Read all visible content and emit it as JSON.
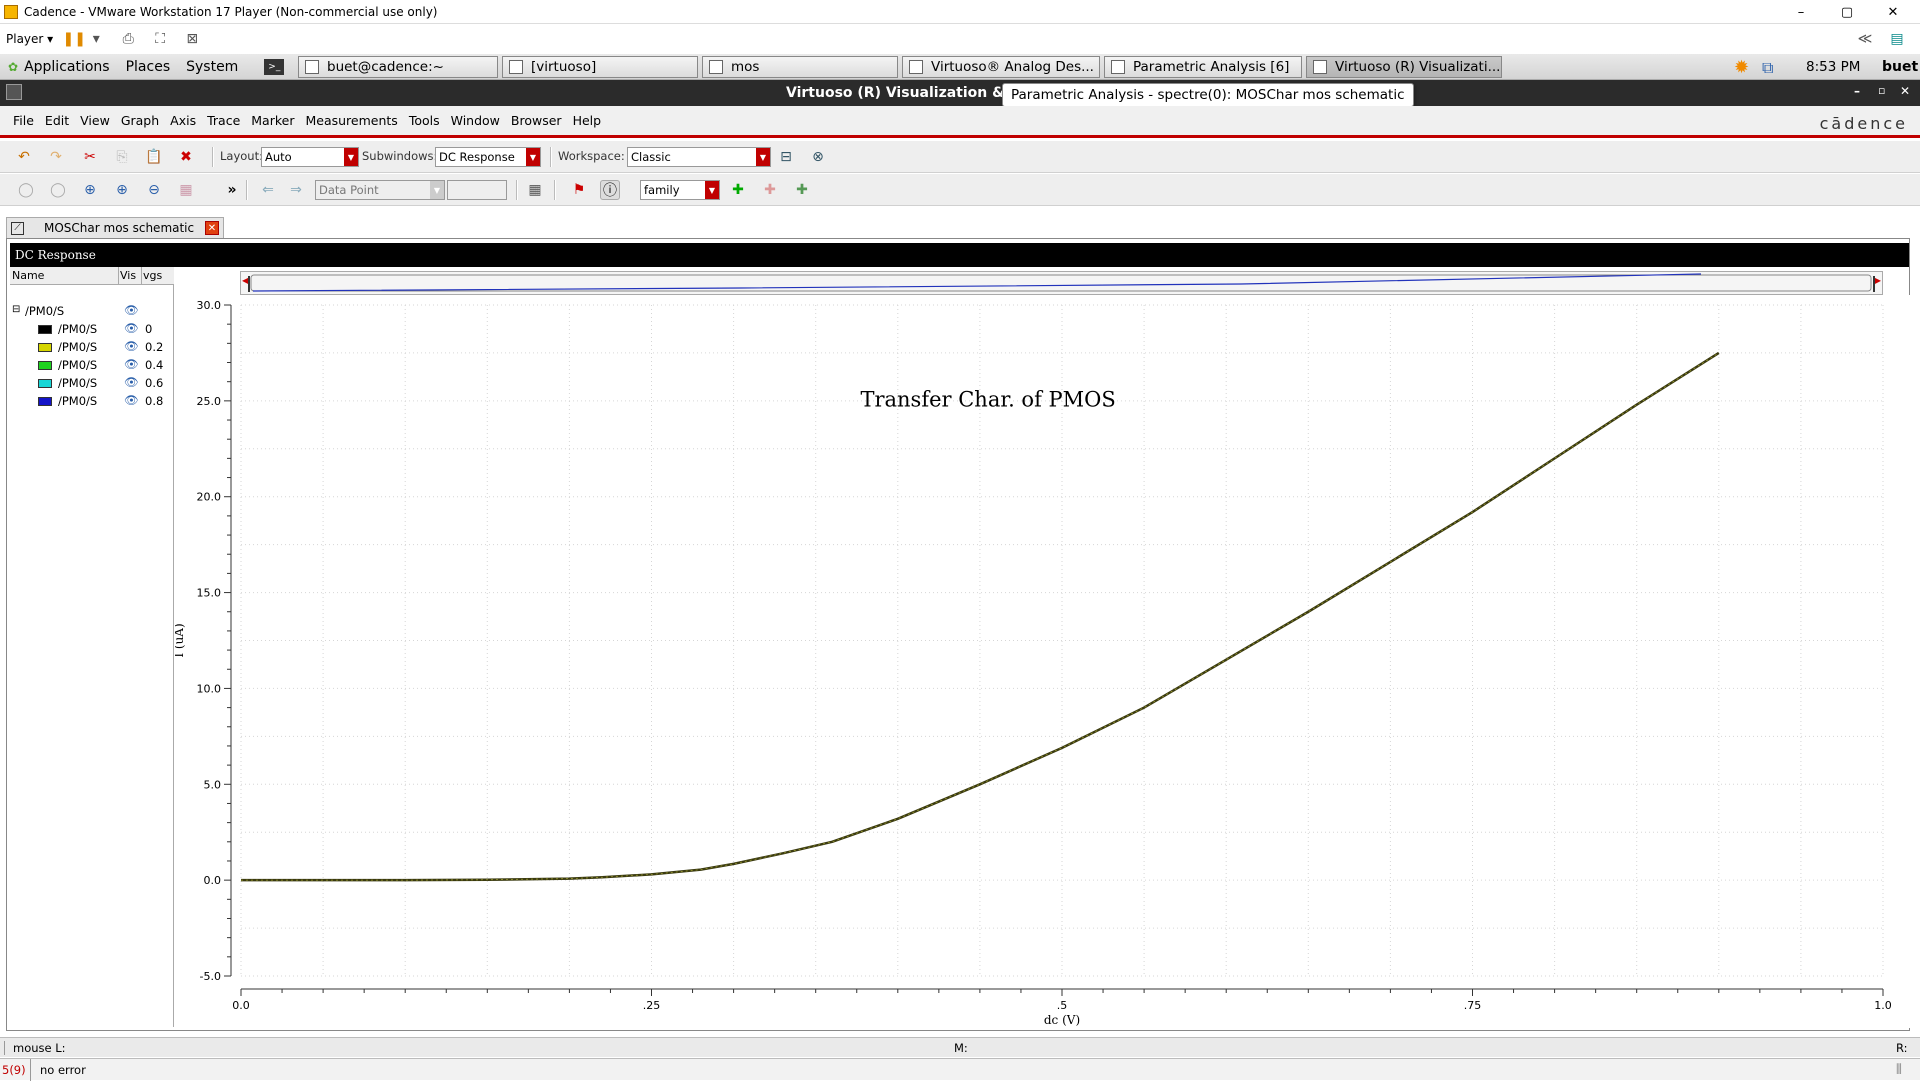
{
  "vmware": {
    "title": "Cadence - VMware Workstation 17 Player (Non-commercial use only)",
    "player_label": "Player"
  },
  "gnome": {
    "menus": [
      "Applications",
      "Places",
      "System"
    ],
    "tasks": [
      "buet@cadence:~",
      "[virtuoso]",
      "mos",
      "Virtuoso® Analog Des...",
      "Parametric Analysis [6]",
      "Virtuoso (R) Visualizati..."
    ],
    "clock": "8:53 PM",
    "user": "buet"
  },
  "virtuoso": {
    "title": "Virtuoso (R) Visualization & ",
    "tooltip": "Parametric Analysis - spectre(0): MOSChar mos schematic",
    "menus": [
      "File",
      "Edit",
      "View",
      "Graph",
      "Axis",
      "Trace",
      "Marker",
      "Measurements",
      "Tools",
      "Window",
      "Browser",
      "Help"
    ],
    "brand": "cādence"
  },
  "toolbar": {
    "layout_label": "Layout:",
    "layout_value": "Auto",
    "subwindows_label": "Subwindows:",
    "subwindows_value": "DC Response",
    "workspace_label": "Workspace:",
    "workspace_value": "Classic",
    "datapoint_value": "Data Point",
    "family_value": "family",
    "more": "»"
  },
  "document": {
    "tab": "MOSChar mos schematic",
    "subwindow": "DC Response"
  },
  "legend": {
    "col_name": "Name",
    "col_vis": "Vis",
    "col_vgs": "vgs",
    "group": "/PM0/S",
    "rows": [
      {
        "name": "/PM0/S",
        "vgs": "0",
        "color": "#000000"
      },
      {
        "name": "/PM0/S",
        "vgs": "0.2",
        "color": "#d6d600"
      },
      {
        "name": "/PM0/S",
        "vgs": "0.4",
        "color": "#1fd41f"
      },
      {
        "name": "/PM0/S",
        "vgs": "0.6",
        "color": "#18d6d6"
      },
      {
        "name": "/PM0/S",
        "vgs": "0.8",
        "color": "#1414c8"
      }
    ]
  },
  "chart_data": {
    "type": "line",
    "title": "Transfer Char. of PMOS",
    "xlabel": "dc (V)",
    "ylabel": "I (uA)",
    "xlim": [
      0,
      1.0
    ],
    "ylim": [
      -5.0,
      30.0
    ],
    "x_ticks": [
      "0.0",
      ".25",
      ".5",
      ".75",
      "1.0"
    ],
    "y_ticks": [
      "-5.0",
      "0.0",
      "5.0",
      "10.0",
      "15.0",
      "20.0",
      "25.0",
      "30.0"
    ],
    "grid": true,
    "series": [
      {
        "name": "/PM0/S",
        "color": "#3a3a10",
        "x": [
          0,
          0.1,
          0.15,
          0.2,
          0.22,
          0.25,
          0.28,
          0.3,
          0.33,
          0.36,
          0.4,
          0.45,
          0.5,
          0.55,
          0.6,
          0.65,
          0.7,
          0.75,
          0.8,
          0.85,
          0.9
        ],
        "y": [
          0,
          0,
          0.02,
          0.08,
          0.15,
          0.3,
          0.55,
          0.85,
          1.4,
          2.0,
          3.2,
          5.0,
          6.9,
          9.0,
          11.5,
          14.0,
          16.6,
          19.2,
          22.0,
          24.8,
          27.5
        ]
      }
    ]
  },
  "status": {
    "mouse": "mouse L:",
    "middle": "M:",
    "right": "R:",
    "count": "5(9)",
    "message": "no error"
  }
}
